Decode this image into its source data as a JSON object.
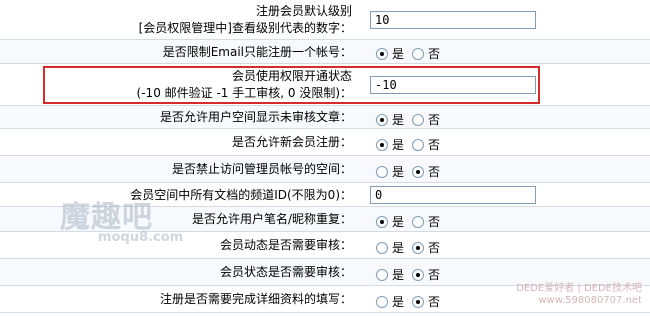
{
  "settings": [
    {
      "label_lines": [
        "注册会员默认级别",
        "[会员权限管理中]查看级别代表的数字："
      ],
      "type": "text",
      "value": "10"
    },
    {
      "label_lines": [
        "是否限制Email只能注册一个帐号："
      ],
      "type": "radio",
      "selected": "是"
    },
    {
      "label_lines": [
        "会员使用权限开通状态",
        "(-10 邮件验证 -1 手工审核, 0 没限制)："
      ],
      "type": "text",
      "value": "-10"
    },
    {
      "label_lines": [
        "是否允许用户空间显示未审核文章："
      ],
      "type": "radio",
      "selected": "是"
    },
    {
      "label_lines": [
        "是否允许新会员注册："
      ],
      "type": "radio",
      "selected": "是"
    },
    {
      "label_lines": [
        "是否禁止访问管理员帐号的空间："
      ],
      "type": "radio",
      "selected": "否"
    },
    {
      "label_lines": [
        "会员空间中所有文档的频道ID(不限为0)："
      ],
      "type": "text",
      "value": "0"
    },
    {
      "label_lines": [
        "是否允许用户笔名/昵称重复："
      ],
      "type": "radio",
      "selected": "是"
    },
    {
      "label_lines": [
        "会员动态是否需要审核："
      ],
      "type": "radio",
      "selected": "否"
    },
    {
      "label_lines": [
        "会员状态是否需要审核："
      ],
      "type": "radio",
      "selected": "否"
    },
    {
      "label_lines": [
        "注册是否需要完成详细资料的填写："
      ],
      "type": "radio",
      "selected": "否"
    }
  ],
  "radio_options": [
    "是",
    "否"
  ],
  "highlight_color": "#d52b2b",
  "watermark_left": {
    "big": "魔趣吧",
    "small": "moqu8.com"
  },
  "watermark_right": [
    "DEDE爱好者 | DEDE技术吧",
    "www.598080707.net"
  ]
}
